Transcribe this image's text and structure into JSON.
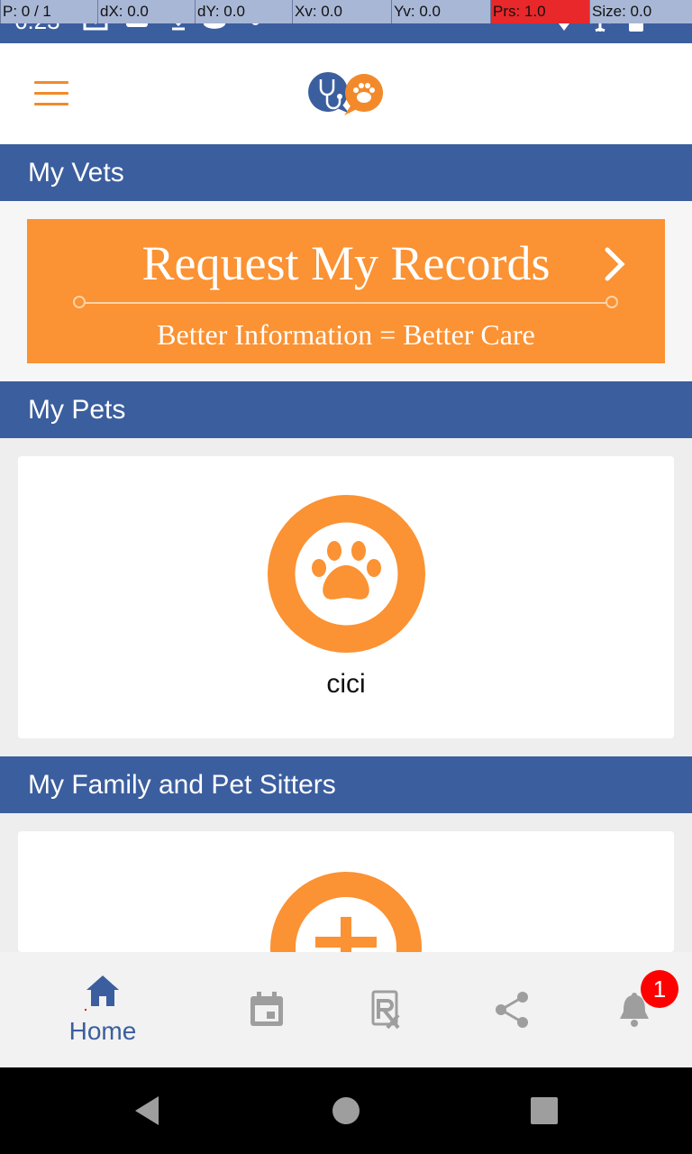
{
  "status_bar": {
    "time": "6:23",
    "debug": [
      {
        "label": "P: 0 / 1"
      },
      {
        "label": "dX: 0.0"
      },
      {
        "label": "dY: 0.0"
      },
      {
        "label": "Xv: 0.0"
      },
      {
        "label": "Yv: 0.0"
      },
      {
        "label": "Prs: 1.0"
      },
      {
        "label": "Size: 0.0"
      }
    ]
  },
  "sections": {
    "vets": "My Vets",
    "pets": "My Pets",
    "family": "My Family and Pet Sitters"
  },
  "banner": {
    "title": "Request My Records",
    "subtitle": "Better Information = Better Care"
  },
  "pets": [
    {
      "name": "cici"
    }
  ],
  "bottom_nav": {
    "home_label": "Home",
    "notification_count": "1",
    "icons": [
      "home-icon",
      "calendar-icon",
      "prescription-icon",
      "share-icon",
      "bell-icon"
    ]
  },
  "colors": {
    "primary": "#3b5e9e",
    "accent": "#fb9233",
    "badge": "#ff0000"
  }
}
